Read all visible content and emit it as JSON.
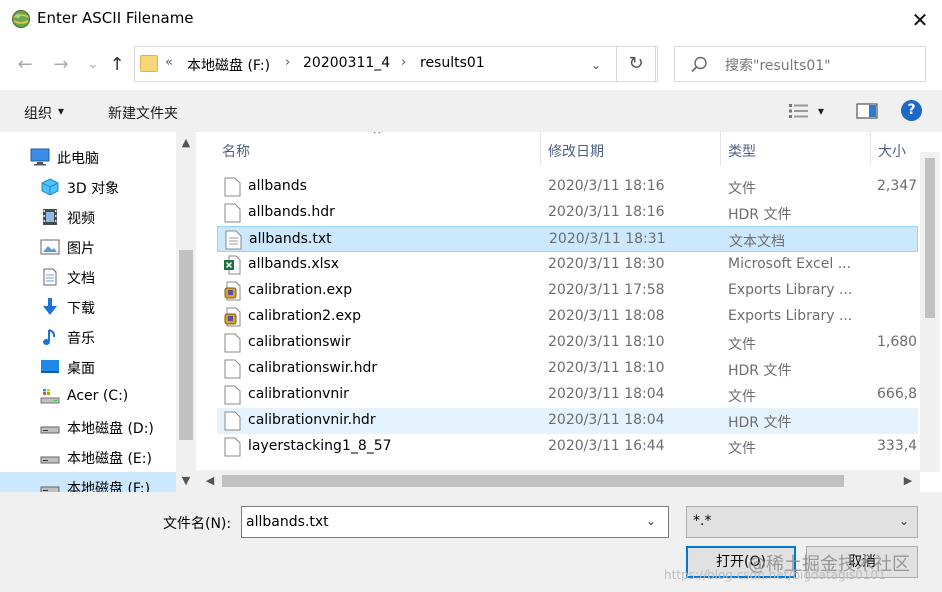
{
  "window": {
    "title": "Enter ASCII Filename",
    "close_glyph": "✕"
  },
  "nav_buttons": {
    "back": "←",
    "forward": "→",
    "recent": "⌄",
    "up": "↑"
  },
  "address": {
    "prefix": "«",
    "crumbs": [
      "本地磁盘 (F:)",
      "20200311_4",
      "results01"
    ],
    "separator": "›",
    "dropdown": "⌄",
    "refresh": "↻"
  },
  "search": {
    "placeholder": "搜索\"results01\""
  },
  "toolbar": {
    "organize": "组织",
    "organize_caret": "▾",
    "new_folder": "新建文件夹",
    "view_caret": "▾",
    "help": "?"
  },
  "sidebar": {
    "items": [
      {
        "label": "此电脑",
        "icon": "computer-icon"
      },
      {
        "label": "3D 对象",
        "icon": "3d-objects-icon"
      },
      {
        "label": "视频",
        "icon": "videos-icon"
      },
      {
        "label": "图片",
        "icon": "pictures-icon"
      },
      {
        "label": "文档",
        "icon": "documents-icon"
      },
      {
        "label": "下载",
        "icon": "downloads-icon"
      },
      {
        "label": "音乐",
        "icon": "music-icon"
      },
      {
        "label": "桌面",
        "icon": "desktop-icon"
      },
      {
        "label": "Acer (C:)",
        "icon": "system-drive-icon"
      },
      {
        "label": "本地磁盘 (D:)",
        "icon": "drive-icon"
      },
      {
        "label": "本地磁盘 (E:)",
        "icon": "drive-icon"
      },
      {
        "label": "本地磁盘 (F:)",
        "icon": "drive-icon"
      }
    ],
    "scroll_up": "▲",
    "scroll_down": "▼"
  },
  "columns": {
    "name": "名称",
    "date": "修改日期",
    "type": "类型",
    "size": "大小",
    "sort_caret": "^"
  },
  "files": [
    {
      "name": "allbands",
      "date": "2020/3/11 18:16",
      "type": "文件",
      "size": "2,347",
      "icon": "blank-file-icon"
    },
    {
      "name": "allbands.hdr",
      "date": "2020/3/11 18:16",
      "type": "HDR 文件",
      "size": "",
      "icon": "blank-file-icon"
    },
    {
      "name": "allbands.txt",
      "date": "2020/3/11 18:31",
      "type": "文本文档",
      "size": "",
      "icon": "text-file-icon"
    },
    {
      "name": "allbands.xlsx",
      "date": "2020/3/11 18:30",
      "type": "Microsoft Excel ...",
      "size": "",
      "icon": "excel-file-icon"
    },
    {
      "name": "calibration.exp",
      "date": "2020/3/11 17:58",
      "type": "Exports Library ...",
      "size": "",
      "icon": "exp-file-icon"
    },
    {
      "name": "calibration2.exp",
      "date": "2020/3/11 18:08",
      "type": "Exports Library ...",
      "size": "",
      "icon": "exp-file-icon"
    },
    {
      "name": "calibrationswir",
      "date": "2020/3/11 18:10",
      "type": "文件",
      "size": "1,680",
      "icon": "blank-file-icon"
    },
    {
      "name": "calibrationswir.hdr",
      "date": "2020/3/11 18:10",
      "type": "HDR 文件",
      "size": "",
      "icon": "blank-file-icon"
    },
    {
      "name": "calibrationvnir",
      "date": "2020/3/11 18:04",
      "type": "文件",
      "size": "666,8",
      "icon": "blank-file-icon"
    },
    {
      "name": "calibrationvnir.hdr",
      "date": "2020/3/11 18:04",
      "type": "HDR 文件",
      "size": "",
      "icon": "blank-file-icon"
    },
    {
      "name": "layerstacking1_8_57",
      "date": "2020/3/11 16:44",
      "type": "文件",
      "size": "333,4",
      "icon": "blank-file-icon"
    }
  ],
  "list_scroll": {
    "up": "▲",
    "down": "▼",
    "left": "◀",
    "right": "▶"
  },
  "footer": {
    "filename_label": "文件名(N):",
    "filename_value": "allbands.txt",
    "filter_value": "*.*",
    "dropdown": "⌄",
    "open_label": "打开(O)",
    "cancel_label": "取消",
    "watermark": "@稀土掘金技术社区",
    "watermark_url": "https://blog.csdn.net/bigdatagis0101"
  },
  "colors": {
    "selection": "#cce8ff",
    "selection_border": "#99d1ff",
    "accent": "#0078d7",
    "header_text": "#4d6082"
  }
}
